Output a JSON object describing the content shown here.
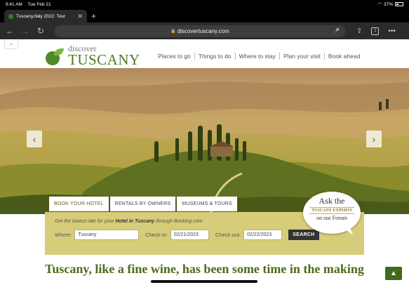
{
  "status_bar": {
    "time": "8:41 AM",
    "date": "Tue Feb 21",
    "battery": "37%"
  },
  "browser": {
    "tab_title": "Tuscany,Italy 2022: Tour",
    "url": "discovertuscany.com",
    "tabs_count": "1"
  },
  "site": {
    "logo_discover": "discover",
    "logo_tuscany": "TUSCANY",
    "nav": [
      "Places to go",
      "Things to do",
      "Where to stay",
      "Plan your visit",
      "Book ahead"
    ]
  },
  "booking": {
    "tabs": [
      "BOOK YOUR HOTEL",
      "RENTALS BY OWNERS",
      "MUSEUMS & TOURS"
    ],
    "note_prefix": "Get the lowest rate for your ",
    "note_bold": "Hotel in Tuscany",
    "note_suffix": " through Booking.com",
    "where_label": "Where:",
    "where_value": "Tuscany",
    "checkin_label": "Check-in:",
    "checkin_value": "02/21/2023",
    "checkout_label": "Check-out:",
    "checkout_value": "02/22/2023",
    "search_label": "SEARCH"
  },
  "ask_bubble": {
    "line1": "Ask the",
    "line2": "TUSCANY EXPERTS",
    "line3": "on our Forum"
  },
  "headline": "Tuscany, like a fine wine, has been some time in the making",
  "colors": {
    "brand_green": "#4d7a1f",
    "booking_panel": "#d7cc7a"
  }
}
